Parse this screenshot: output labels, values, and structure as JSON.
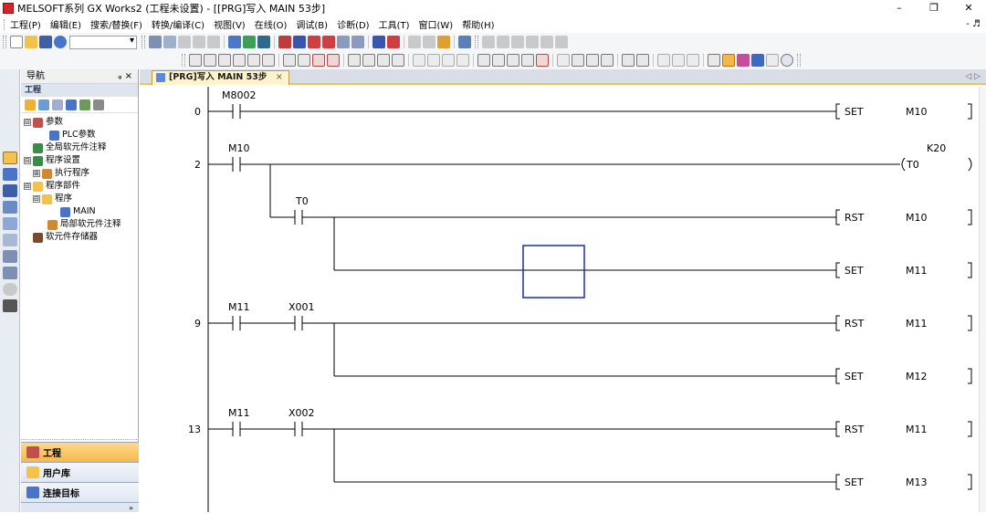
{
  "window": {
    "title": "MELSOFT系列 GX Works2 (工程未设置) - [[PRG]写入 MAIN 53步]",
    "controls": [
      "–",
      "❐",
      "✕"
    ]
  },
  "menubar": {
    "items": [
      "工程(P)",
      "编辑(E)",
      "搜索/替换(F)",
      "转换/编译(C)",
      "视图(V)",
      "在线(O)",
      "调试(B)",
      "诊断(D)",
      "工具(T)",
      "窗口(W)",
      "帮助(H)"
    ],
    "right": "- ♬"
  },
  "nav": {
    "header": "导航",
    "pin": "ᵩ ×",
    "section": "工程",
    "tree": [
      {
        "label": "参数",
        "level": 0,
        "expander": "⊟"
      },
      {
        "label": "PLC参数",
        "level": 2,
        "expander": ""
      },
      {
        "label": "全局软元件注释",
        "level": 1,
        "expander": ""
      },
      {
        "label": "程序设置",
        "level": 0,
        "expander": "⊟"
      },
      {
        "label": "执行程序",
        "level": 1,
        "expander": "⊞"
      },
      {
        "label": "程序部件",
        "level": 0,
        "expander": "⊟"
      },
      {
        "label": "程序",
        "level": 1,
        "expander": "⊟"
      },
      {
        "label": "MAIN",
        "level": 3,
        "expander": ""
      },
      {
        "label": "局部软元件注释",
        "level": 2,
        "expander": ""
      },
      {
        "label": "软元件存储器",
        "level": 1,
        "expander": ""
      }
    ],
    "bottom_tabs": [
      "工程",
      "用户库",
      "连接目标"
    ],
    "more": "»"
  },
  "editor": {
    "tab_label": "[PRG]写入 MAIN 53步",
    "tab_close": "×",
    "tab_scroll": "◁ ▷"
  },
  "ladder": {
    "rungs": [
      {
        "step": "0",
        "contacts": [
          "M8002"
        ],
        "instr": "SET",
        "operand": "M10"
      },
      {
        "step": "2",
        "contacts": [
          "M10"
        ],
        "coil": "T0",
        "const": "K20"
      },
      {
        "step": "",
        "contacts": [
          "T0"
        ],
        "instr": "RST",
        "operand": "M10"
      },
      {
        "step": "",
        "contacts": [],
        "instr": "SET",
        "operand": "M11"
      },
      {
        "step": "9",
        "contacts": [
          "M11",
          "X001"
        ],
        "instr": "RST",
        "operand": "M11"
      },
      {
        "step": "",
        "contacts": [],
        "instr": "SET",
        "operand": "M12"
      },
      {
        "step": "13",
        "contacts": [
          "M11",
          "X002"
        ],
        "instr": "RST",
        "operand": "M11"
      },
      {
        "step": "",
        "contacts": [],
        "instr": "SET",
        "operand": "M13"
      }
    ]
  },
  "colors": {
    "cursor": "#1b2fa8",
    "tab_accent": "#f0c45c"
  }
}
